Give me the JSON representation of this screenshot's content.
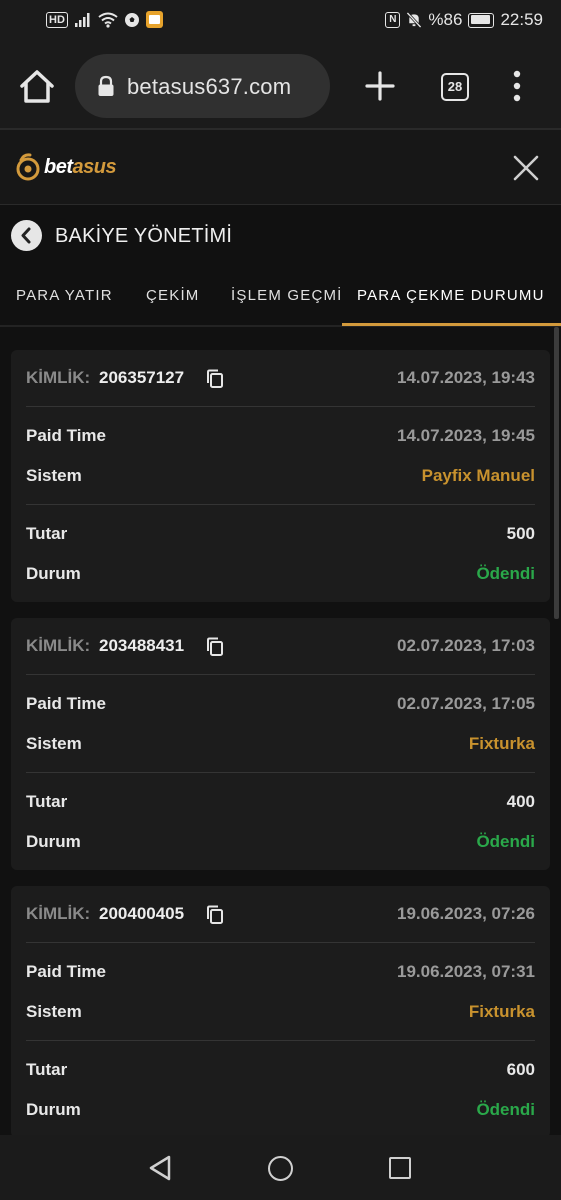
{
  "status_bar": {
    "network_badge": "HD",
    "battery": "%86",
    "time": "22:59"
  },
  "browser": {
    "url": "betasus637.com",
    "tab_count": "28"
  },
  "site": {
    "logo_text_main": "bet",
    "logo_text_accent": "asus",
    "brand_color": "#d39a3c"
  },
  "page": {
    "title": "BAKİYE YÖNETİMİ"
  },
  "tabs": [
    {
      "label": "PARA YATIR",
      "active": false
    },
    {
      "label": "ÇEKİM",
      "active": false
    },
    {
      "label": "İŞLEM GEÇMİ",
      "active": false
    },
    {
      "label": "PARA ÇEKME DURUMU",
      "active": true
    }
  ],
  "labels": {
    "id_label": "KİMLİK:",
    "paid_time": "Paid Time",
    "system": "Sistem",
    "amount": "Tutar",
    "status": "Durum"
  },
  "withdrawals": [
    {
      "id": "206357127",
      "created": "14.07.2023, 19:43",
      "paid_time": "14.07.2023, 19:45",
      "system": "Payfix Manuel",
      "amount": "500",
      "status": "Ödendi"
    },
    {
      "id": "203488431",
      "created": "02.07.2023, 17:03",
      "paid_time": "02.07.2023, 17:05",
      "system": "Fixturka",
      "amount": "400",
      "status": "Ödendi"
    },
    {
      "id": "200400405",
      "created": "19.06.2023, 07:26",
      "paid_time": "19.06.2023, 07:31",
      "system": "Fixturka",
      "amount": "600",
      "status": "Ödendi"
    }
  ],
  "colors": {
    "system_value": "#c8922e",
    "status_paid": "#2aa84a"
  }
}
